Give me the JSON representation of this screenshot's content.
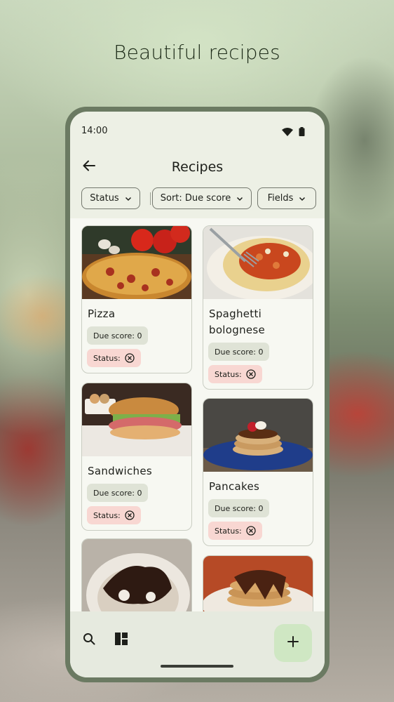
{
  "headline": "Beautiful recipes",
  "status_bar": {
    "time": "14:00",
    "icons": [
      "wifi-icon",
      "battery-icon"
    ]
  },
  "app_bar": {
    "back_icon": "arrow-left-icon",
    "title": "Recipes"
  },
  "filters": {
    "status_label": "Status",
    "sort_label": "Sort: Due score",
    "fields_label": "Fields"
  },
  "recipes": [
    {
      "name": "Pizza",
      "due_score": "Due score: 0",
      "status": "Status:"
    },
    {
      "name": "Spaghetti bolognese",
      "due_score": "Due score: 0",
      "status": "Status:"
    },
    {
      "name": "Sandwiches",
      "due_score": "Due score: 0",
      "status": "Status:"
    },
    {
      "name": "Pancakes",
      "due_score": "Due score: 0",
      "status": "Status:"
    }
  ],
  "bottom_bar": {
    "icons": [
      "search-icon",
      "dashboard-icon"
    ],
    "fab_icon": "plus-icon"
  },
  "colors": {
    "background": "#edf0e5",
    "status_badge": "#f8d7d2",
    "due_badge": "#dfe3d6",
    "fab": "#cfe7c3"
  }
}
